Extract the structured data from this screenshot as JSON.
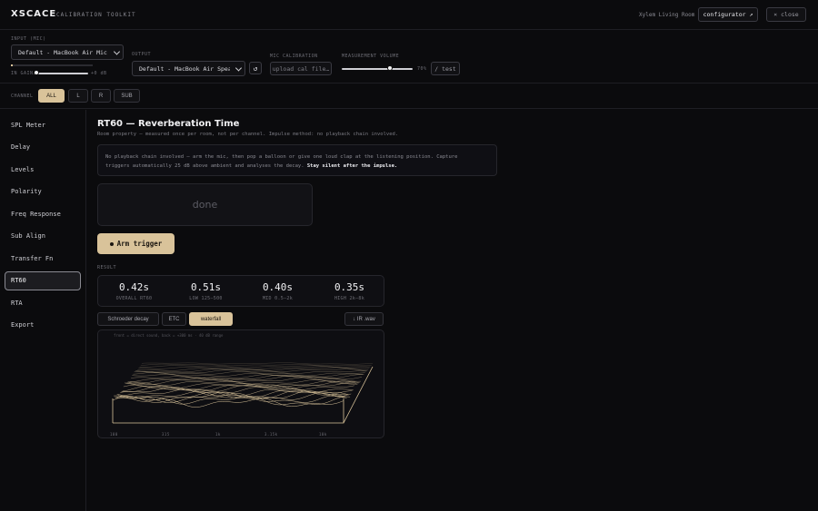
{
  "header": {
    "logo": "XSCACE",
    "logo_subtitle": "CALIBRATION TOOLKIT",
    "room": "Xylem Living Room",
    "configurator_label": "configurator ↗",
    "close_label": "× close"
  },
  "controls": {
    "input_label": "INPUT (MIC)",
    "input_value": "Default - MacBook Air Microphone",
    "in_gain_label": "IN GAIN",
    "in_gain_value": "+0 dB",
    "in_gain_level": 0.0,
    "output_label": "OUTPUT",
    "output_value": "Default - MacBook Air Speakers",
    "refresh_icon": "↺",
    "mic_cal_label": "MIC CALIBRATION",
    "mic_cal_placeholder": "upload cal file…",
    "volume_label": "MEASUREMENT VOLUME",
    "volume_value": "70%",
    "volume_level": 0.7,
    "test_label": "/ test"
  },
  "channel": {
    "label": "CHANNEL",
    "options": [
      "ALL",
      "L",
      "R",
      "SUB"
    ],
    "selected": "ALL"
  },
  "sidebar": {
    "items": [
      "SPL Meter",
      "Delay",
      "Levels",
      "Polarity",
      "Freq Response",
      "Sub Align",
      "Transfer Fn",
      "RT60",
      "RTA",
      "Export"
    ],
    "active": "RT60"
  },
  "main": {
    "title": "RT60 — Reverberation Time",
    "subtitle": "Room property — measured once per room, not per channel. Impulse method: no playback chain involved.",
    "info_line1": "No playback chain involved — arm the mic, then pop a balloon or give one loud clap at the listening position. Capture",
    "info_line2": "triggers automatically 25 dB above ambient and analyses the decay.",
    "info_bold": "Stay silent after the impulse.",
    "status": "done",
    "arm_label": "Arm trigger",
    "result_label": "RESULT",
    "metrics": [
      {
        "value": "0.42s",
        "label": "OVERALL RT60"
      },
      {
        "value": "0.51s",
        "label": "LOW 125–500"
      },
      {
        "value": "0.40s",
        "label": "MID 0.5–2k"
      },
      {
        "value": "0.35s",
        "label": "HIGH 2k–8k"
      }
    ],
    "tabs": [
      "Schroeder decay",
      "ETC",
      "waterfall"
    ],
    "active_tab": "waterfall",
    "download_label": "↓ IR .wav",
    "waterfall_caption": "front = direct sound, back = +300 ms · 40 dB range",
    "waterfall_axis": [
      "100",
      "315",
      "1k",
      "3.15k",
      "10k"
    ]
  },
  "colors": {
    "accent": "#d9c39a",
    "background": "#0b0b0d",
    "panel": "#0f0f13",
    "border": "#26262c"
  }
}
